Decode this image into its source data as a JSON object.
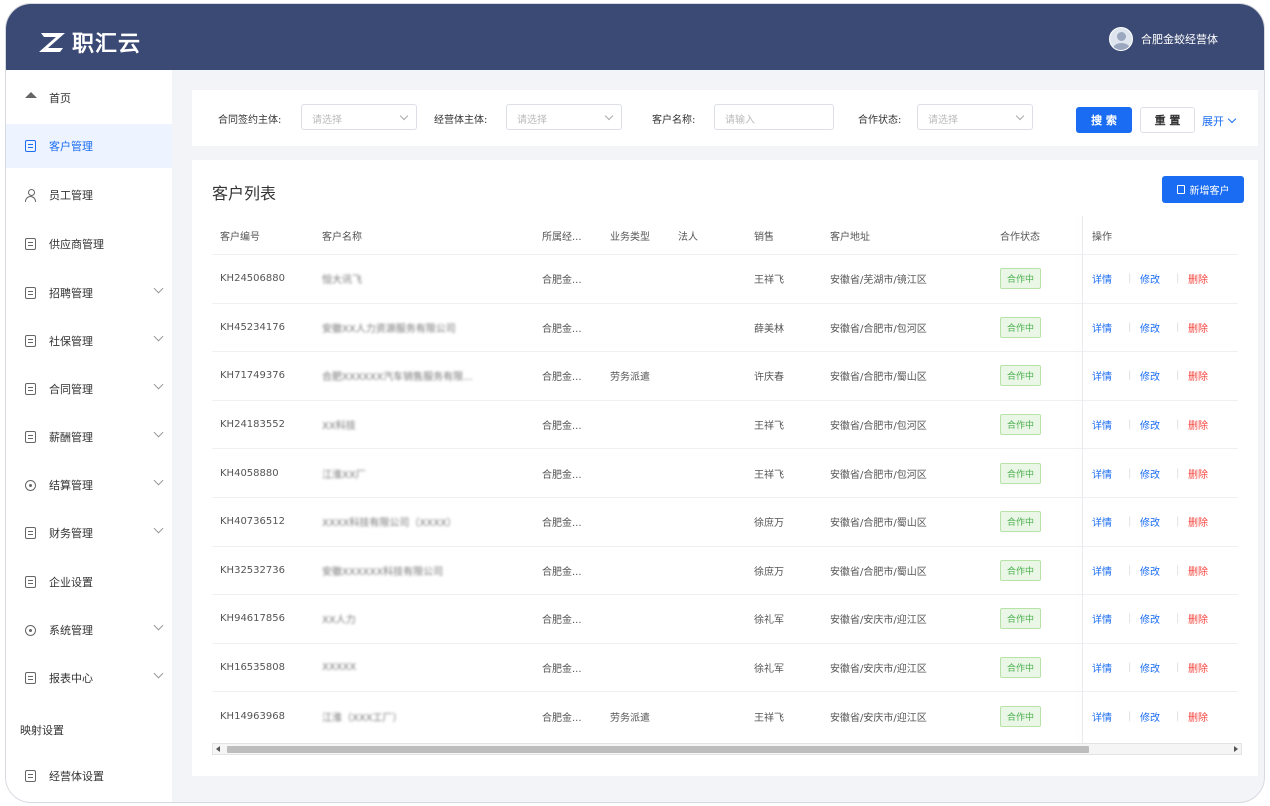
{
  "header": {
    "brand": "职汇云",
    "user_name": "合肥金蛟经营体"
  },
  "sidebar": {
    "items": [
      {
        "label": "首页",
        "icon": "home-icon"
      },
      {
        "label": "客户管理",
        "icon": "document-icon",
        "active": true
      },
      {
        "label": "员工管理",
        "icon": "user-icon"
      },
      {
        "label": "供应商管理",
        "icon": "supplier-icon"
      },
      {
        "label": "招聘管理",
        "icon": "recruit-icon",
        "expandable": true
      },
      {
        "label": "社保管理",
        "icon": "insurance-icon",
        "expandable": true
      },
      {
        "label": "合同管理",
        "icon": "contract-icon",
        "expandable": true
      },
      {
        "label": "薪酬管理",
        "icon": "salary-icon",
        "expandable": true
      },
      {
        "label": "结算管理",
        "icon": "settlement-icon",
        "expandable": true
      },
      {
        "label": "财务管理",
        "icon": "finance-icon",
        "expandable": true
      },
      {
        "label": "企业设置",
        "icon": "enterprise-icon"
      },
      {
        "label": "系统管理",
        "icon": "system-icon",
        "expandable": true
      },
      {
        "label": "报表中心",
        "icon": "report-icon",
        "expandable": true
      }
    ],
    "section_label": "映射设置",
    "section_items": [
      {
        "label": "经营体设置",
        "icon": "settings-icon"
      }
    ]
  },
  "filters": {
    "contract_entity_label": "合同签约主体:",
    "contract_entity_placeholder": "请选择",
    "business_entity_label": "经营体主体:",
    "business_entity_placeholder": "请选择",
    "customer_name_label": "客户名称:",
    "customer_name_placeholder": "请输入",
    "status_label": "合作状态:",
    "status_placeholder": "请选择",
    "search_label": "搜 索",
    "reset_label": "重 置",
    "expand_label": "展开"
  },
  "customer_list": {
    "title": "客户列表",
    "new_button_label": "新增客户",
    "columns": [
      "客户编号",
      "客户名称",
      "所属经...",
      "业务类型",
      "法人",
      "销售",
      "客户地址",
      "合作状态",
      "操作"
    ],
    "rows": [
      {
        "code": "KH24506880",
        "name": "恒大讯飞",
        "owner": "合肥金...",
        "biz_type": "",
        "legal": "",
        "sales": "王祥飞",
        "address": "安徽省/芜湖市/镜江区",
        "status": "合作中"
      },
      {
        "code": "KH45234176",
        "name": "安徽XX人力资源服务有限公司",
        "owner": "合肥金...",
        "biz_type": "",
        "legal": "",
        "sales": "薛美林",
        "address": "安徽省/合肥市/包河区",
        "status": "合作中"
      },
      {
        "code": "KH71749376",
        "name": "合肥XXXXXX汽车销售服务有限...",
        "owner": "合肥金...",
        "biz_type": "劳务派遣",
        "legal": "",
        "sales": "许庆春",
        "address": "安徽省/合肥市/蜀山区",
        "status": "合作中"
      },
      {
        "code": "KH24183552",
        "name": "XX科技",
        "owner": "合肥金...",
        "biz_type": "",
        "legal": "",
        "sales": "王祥飞",
        "address": "安徽省/合肥市/包河区",
        "status": "合作中"
      },
      {
        "code": "KH4058880",
        "name": "江淮XX厂",
        "owner": "合肥金...",
        "biz_type": "",
        "legal": "",
        "sales": "王祥飞",
        "address": "安徽省/合肥市/包河区",
        "status": "合作中"
      },
      {
        "code": "KH40736512",
        "name": "XXXX科技有限公司（XXXX）",
        "owner": "合肥金...",
        "biz_type": "",
        "legal": "",
        "sales": "徐庶万",
        "address": "安徽省/合肥市/蜀山区",
        "status": "合作中"
      },
      {
        "code": "KH32532736",
        "name": "安徽XXXXXX科技有限公司",
        "owner": "合肥金...",
        "biz_type": "",
        "legal": "",
        "sales": "徐庶万",
        "address": "安徽省/合肥市/蜀山区",
        "status": "合作中"
      },
      {
        "code": "KH94617856",
        "name": "XX人力",
        "owner": "合肥金...",
        "biz_type": "",
        "legal": "",
        "sales": "徐礼军",
        "address": "安徽省/安庆市/迎江区",
        "status": "合作中"
      },
      {
        "code": "KH16535808",
        "name": "XXXXX",
        "owner": "合肥金...",
        "biz_type": "",
        "legal": "",
        "sales": "徐礼军",
        "address": "安徽省/安庆市/迎江区",
        "status": "合作中"
      },
      {
        "code": "KH14963968",
        "name": "江淮（XXX工厂）",
        "owner": "合肥金...",
        "biz_type": "劳务派遣",
        "legal": "",
        "sales": "王祥飞",
        "address": "安徽省/安庆市/迎江区",
        "status": "合作中"
      }
    ],
    "actions": {
      "detail": "详情",
      "edit": "修改",
      "delete": "删除"
    }
  },
  "colors": {
    "topbar": "#3b4a74",
    "primary": "#1a6cf2",
    "danger": "#f5433c",
    "success": "#4caf50"
  }
}
